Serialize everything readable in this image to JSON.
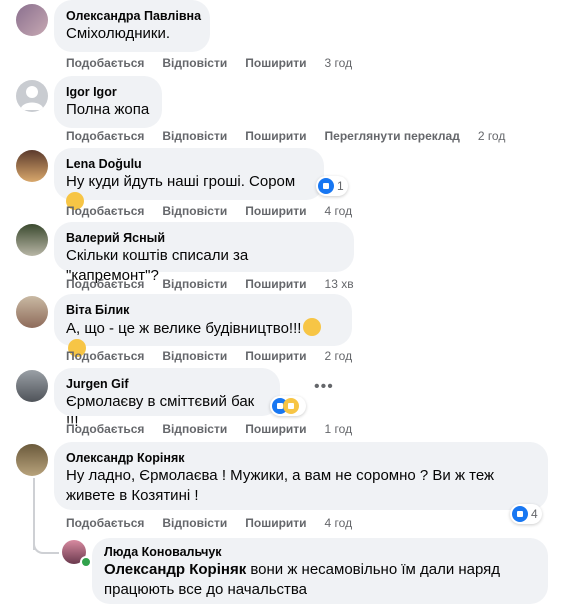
{
  "labels": {
    "like": "Подобається",
    "reply": "Відповісти",
    "share": "Поширити",
    "translate": "Переглянути переклад"
  },
  "comments": [
    {
      "author": "Олександра Павлівна",
      "text": "Сміхолюдники.",
      "time": "3 год"
    },
    {
      "author": "Igor Igor",
      "text": "Полна жопа",
      "time": "2 год"
    },
    {
      "author": "Lena Doğulu",
      "text": "Ну куди йдуть наші гроші. Сором",
      "time": "4 год",
      "reactions": "1"
    },
    {
      "author": "Валерий Ясный",
      "text": "Скільки коштів списали за \"капремонт\"?",
      "time": "13 хв"
    },
    {
      "author": "Віта Білик",
      "text": "А, що - це ж велике будівництво!!!",
      "time": "2 год"
    },
    {
      "author": "Jurgen Gif",
      "text": "Єрмолаєву в сміттєвий бак !!!",
      "time": "1 год"
    },
    {
      "author": "Олександр Коріняк",
      "text": "Ну ладно, Єрмолаєва ! Мужики, а вам не соромно ? Ви ж теж живете в Козятині !",
      "time": "4 год",
      "reactions": "4"
    }
  ],
  "reply": {
    "author": "Люда Коновальчук",
    "mention": "Олександр Коріняк",
    "text": "вони ж несамовільно їм дали наряд працюють все до начальства"
  },
  "colors": {
    "like_blue": "#1877f2",
    "bubble": "#f0f2f5",
    "meta": "#65676b"
  }
}
